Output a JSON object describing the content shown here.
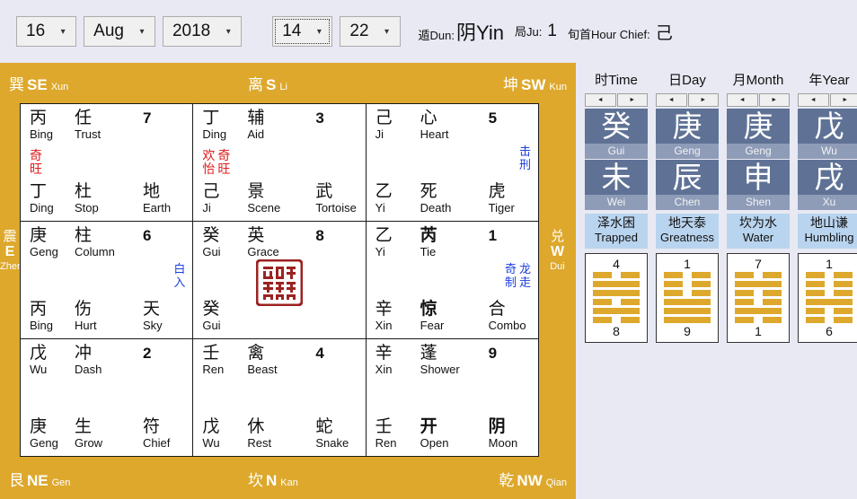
{
  "toolbar": {
    "day": "16",
    "month": "Aug",
    "year": "2018",
    "hour": "14",
    "minute": "22",
    "dun_cn": "遁",
    "dun_label": "Dun:",
    "dun_value_cn": "阴",
    "dun_value_en": "Yin",
    "ju_cn": "局",
    "ju_label": "Ju:",
    "ju_value": "1",
    "chief_cn": "旬首",
    "chief_label": "Hour Chief:",
    "chief_value": "己"
  },
  "board": {
    "edges": {
      "se": {
        "cn": "巽",
        "abbr": "SE",
        "py": "Xun"
      },
      "s": {
        "cn": "离",
        "abbr": "S",
        "py": "Li"
      },
      "sw": {
        "cn": "坤",
        "abbr": "SW",
        "py": "Kun"
      },
      "e": {
        "cn": "震",
        "abbr": "E",
        "py": "Zhen"
      },
      "w": {
        "cn": "兑",
        "abbr": "W",
        "py": "Dui"
      },
      "ne": {
        "cn": "艮",
        "abbr": "NE",
        "py": "Gen"
      },
      "n": {
        "cn": "坎",
        "abbr": "N",
        "py": "Kan"
      },
      "nw": {
        "cn": "乾",
        "abbr": "NW",
        "py": "Qian"
      }
    },
    "cells": [
      {
        "palace": "7",
        "top": [
          {
            "cn": "丙",
            "en": "Bing",
            "bold": false
          },
          {
            "cn": "任",
            "en": "Trust",
            "bold": false
          }
        ],
        "bottom": [
          {
            "cn": "丁",
            "en": "Ding",
            "bold": false
          },
          {
            "cn": "杜",
            "en": "Stop",
            "bold": false
          },
          {
            "cn": "地",
            "en": "Earth",
            "bold": false
          }
        ],
        "red_marks": [
          [
            "奇",
            "旺"
          ]
        ],
        "blue_marks": []
      },
      {
        "palace": "3",
        "top": [
          {
            "cn": "丁",
            "en": "Ding",
            "bold": false
          },
          {
            "cn": "辅",
            "en": "Aid",
            "bold": false
          }
        ],
        "bottom": [
          {
            "cn": "己",
            "en": "Ji",
            "bold": false
          },
          {
            "cn": "景",
            "en": "Scene",
            "bold": false
          },
          {
            "cn": "武",
            "en": "Tortoise",
            "bold": false
          }
        ],
        "red_marks": [
          [
            "欢",
            "怡"
          ],
          [
            "奇",
            "旺"
          ]
        ],
        "blue_marks": []
      },
      {
        "palace": "5",
        "top": [
          {
            "cn": "己",
            "en": "Ji",
            "bold": false
          },
          {
            "cn": "心",
            "en": "Heart",
            "bold": false
          }
        ],
        "bottom": [
          {
            "cn": "乙",
            "en": "Yi",
            "bold": false
          },
          {
            "cn": "死",
            "en": "Death",
            "bold": false
          },
          {
            "cn": "虎",
            "en": "Tiger",
            "bold": false
          }
        ],
        "red_marks": [],
        "blue_marks": [
          [
            "击",
            "刑"
          ]
        ]
      },
      {
        "palace": "6",
        "top": [
          {
            "cn": "庚",
            "en": "Geng",
            "bold": false
          },
          {
            "cn": "柱",
            "en": "Column",
            "bold": false
          }
        ],
        "bottom": [
          {
            "cn": "丙",
            "en": "Bing",
            "bold": false
          },
          {
            "cn": "伤",
            "en": "Hurt",
            "bold": false
          },
          {
            "cn": "天",
            "en": "Sky",
            "bold": false
          }
        ],
        "red_marks": [],
        "blue_marks": [
          [
            "白",
            "入"
          ]
        ]
      },
      {
        "palace": "8",
        "top": [
          {
            "cn": "癸",
            "en": "Gui",
            "bold": false
          },
          {
            "cn": "英",
            "en": "Grace",
            "bold": false
          }
        ],
        "bottom": [
          {
            "cn": "癸",
            "en": "Gui",
            "bold": false
          }
        ],
        "red_marks": [],
        "blue_marks": [],
        "seal": true
      },
      {
        "palace": "1",
        "top": [
          {
            "cn": "乙",
            "en": "Yi",
            "bold": false
          },
          {
            "cn": "芮",
            "en": "Tie",
            "bold": true
          }
        ],
        "bottom": [
          {
            "cn": "辛",
            "en": "Xin",
            "bold": false
          },
          {
            "cn": "惊",
            "en": "Fear",
            "bold": true
          },
          {
            "cn": "合",
            "en": "Combo",
            "bold": false
          }
        ],
        "red_marks": [],
        "blue_marks": [
          [
            "奇",
            "制"
          ],
          [
            "龙",
            "走"
          ]
        ]
      },
      {
        "palace": "2",
        "top": [
          {
            "cn": "戊",
            "en": "Wu",
            "bold": false
          },
          {
            "cn": "冲",
            "en": "Dash",
            "bold": false
          }
        ],
        "bottom": [
          {
            "cn": "庚",
            "en": "Geng",
            "bold": false
          },
          {
            "cn": "生",
            "en": "Grow",
            "bold": false
          },
          {
            "cn": "符",
            "en": "Chief",
            "bold": false
          }
        ],
        "red_marks": [],
        "blue_marks": []
      },
      {
        "palace": "4",
        "top": [
          {
            "cn": "壬",
            "en": "Ren",
            "bold": false
          },
          {
            "cn": "禽",
            "en": "Beast",
            "bold": false
          }
        ],
        "bottom": [
          {
            "cn": "戊",
            "en": "Wu",
            "bold": false
          },
          {
            "cn": "休",
            "en": "Rest",
            "bold": false
          },
          {
            "cn": "蛇",
            "en": "Snake",
            "bold": false
          }
        ],
        "red_marks": [],
        "blue_marks": []
      },
      {
        "palace": "9",
        "top": [
          {
            "cn": "辛",
            "en": "Xin",
            "bold": false
          },
          {
            "cn": "蓬",
            "en": "Shower",
            "bold": false
          }
        ],
        "bottom": [
          {
            "cn": "壬",
            "en": "Ren",
            "bold": false
          },
          {
            "cn": "开",
            "en": "Open",
            "bold": true
          },
          {
            "cn": "阴",
            "en": "Moon",
            "bold": true
          }
        ],
        "red_marks": [],
        "blue_marks": []
      }
    ]
  },
  "pillars": [
    {
      "title": "时Time",
      "prev": "◄",
      "next": "►",
      "stem_cn": "癸",
      "stem_rom": "Gui",
      "branch_cn": "未",
      "branch_rom": "Wei",
      "gua_cn": "泽水困",
      "gua_en": "Trapped",
      "hex_top": "4",
      "hex_bottom": "8",
      "hex_lines": [
        "broken",
        "solid",
        "solid",
        "broken",
        "solid",
        "broken"
      ]
    },
    {
      "title": "日Day",
      "prev": "◄",
      "next": "►",
      "stem_cn": "庚",
      "stem_rom": "Geng",
      "branch_cn": "辰",
      "branch_rom": "Chen",
      "gua_cn": "地天泰",
      "gua_en": "Greatness",
      "hex_top": "1",
      "hex_bottom": "9",
      "hex_lines": [
        "broken",
        "broken",
        "broken",
        "solid",
        "solid",
        "solid"
      ]
    },
    {
      "title": "月Month",
      "prev": "◄",
      "next": "►",
      "stem_cn": "庚",
      "stem_rom": "Geng",
      "branch_cn": "申",
      "branch_rom": "Shen",
      "gua_cn": "坎为水",
      "gua_en": "Water",
      "hex_top": "7",
      "hex_bottom": "1",
      "hex_lines": [
        "broken",
        "solid",
        "broken",
        "broken",
        "solid",
        "broken"
      ]
    },
    {
      "title": "年Year",
      "prev": "◄",
      "next": "►",
      "stem_cn": "戊",
      "stem_rom": "Wu",
      "branch_cn": "戌",
      "branch_rom": "Xu",
      "gua_cn": "地山谦",
      "gua_en": "Humbling",
      "hex_top": "1",
      "hex_bottom": "6",
      "hex_lines": [
        "broken",
        "broken",
        "broken",
        "solid",
        "broken",
        "broken"
      ]
    }
  ],
  "colors": {
    "board_bg": "#dda82c",
    "panel_bg": "#e8e9f3",
    "pillar_blue": "#5f7296",
    "gua_blue": "#b9d4ee",
    "red_mark": "#e01b1b",
    "blue_mark": "#1b3fe0"
  }
}
